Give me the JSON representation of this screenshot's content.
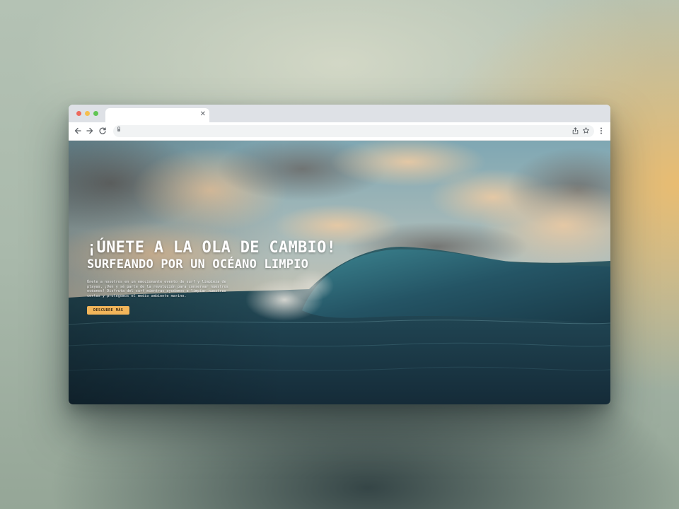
{
  "browser": {
    "tab": {
      "title": "",
      "close_glyph": "✕"
    },
    "address_bar": {
      "url": ""
    },
    "icons": {
      "back": "back-arrow-icon",
      "forward": "forward-arrow-icon",
      "reload": "reload-icon",
      "lock": "lock-icon",
      "share": "share-icon",
      "bookmark": "star-icon",
      "menu": "kebab-menu-icon"
    }
  },
  "hero": {
    "title": "¡ÚNETE A LA OLA DE CAMBIO!",
    "subtitle": "SURFEANDO POR UN OCÉANO LIMPIO",
    "description": "Únete a nosotros en un emocionante evento de surf y limpieza de playas. ¡Ven y sé parte de la revolución para conservar nuestros océanos! Disfruta del surf mientras ayudamos a limpiar nuestras costas y protegemos el medio ambiente marino.",
    "cta_label": "DESCUBRE MÁS"
  },
  "colors": {
    "accent_button": "#f2b55a",
    "traffic_red": "#ed6a5e",
    "traffic_yellow": "#f5bf4f",
    "traffic_green": "#61c554"
  }
}
